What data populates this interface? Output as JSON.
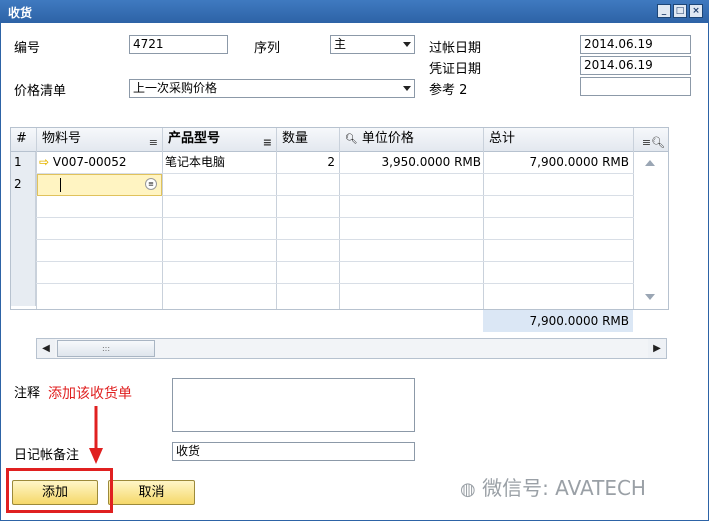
{
  "window": {
    "title": "收货",
    "controls": [
      "_",
      "□",
      "×"
    ]
  },
  "header": {
    "number_label": "编号",
    "number_value": "4721",
    "series_label": "序列",
    "series_value": "主",
    "price_list_label": "价格清单",
    "price_list_value": "上一次采购价格",
    "posting_date_label": "过帐日期",
    "posting_date_value": "2014.06.19",
    "doc_date_label": "凭证日期",
    "doc_date_value": "2014.06.19",
    "reference_label": "参考 2",
    "reference_value": ""
  },
  "grid": {
    "columns": [
      "#",
      "物料号",
      "产品型号",
      "数量",
      "单位价格",
      "总计"
    ],
    "rows": [
      {
        "num": "1",
        "item_no": "V007-00052",
        "model": "笔记本电脑",
        "qty": "2",
        "unit_price": "3,950.0000 RMB",
        "total": "7,900.0000 RMB"
      },
      {
        "num": "2",
        "item_no": "",
        "model": "",
        "qty": "",
        "unit_price": "",
        "total": ""
      }
    ],
    "footer_total": "7,900.0000 RMB",
    "scroll_thumb_grip": ":::"
  },
  "bottom": {
    "remarks_label": "注释",
    "journal_label": "日记帐备注",
    "journal_value": "收货",
    "annotation": "添加该收货单"
  },
  "buttons": {
    "add": "添加",
    "cancel": "取消"
  },
  "watermark": "微信号: AVATECH",
  "colors": {
    "titlebar": "#2d63a6",
    "button": "#f5d86a",
    "annotation": "#e02020",
    "active_cell": "#fff4c2"
  }
}
